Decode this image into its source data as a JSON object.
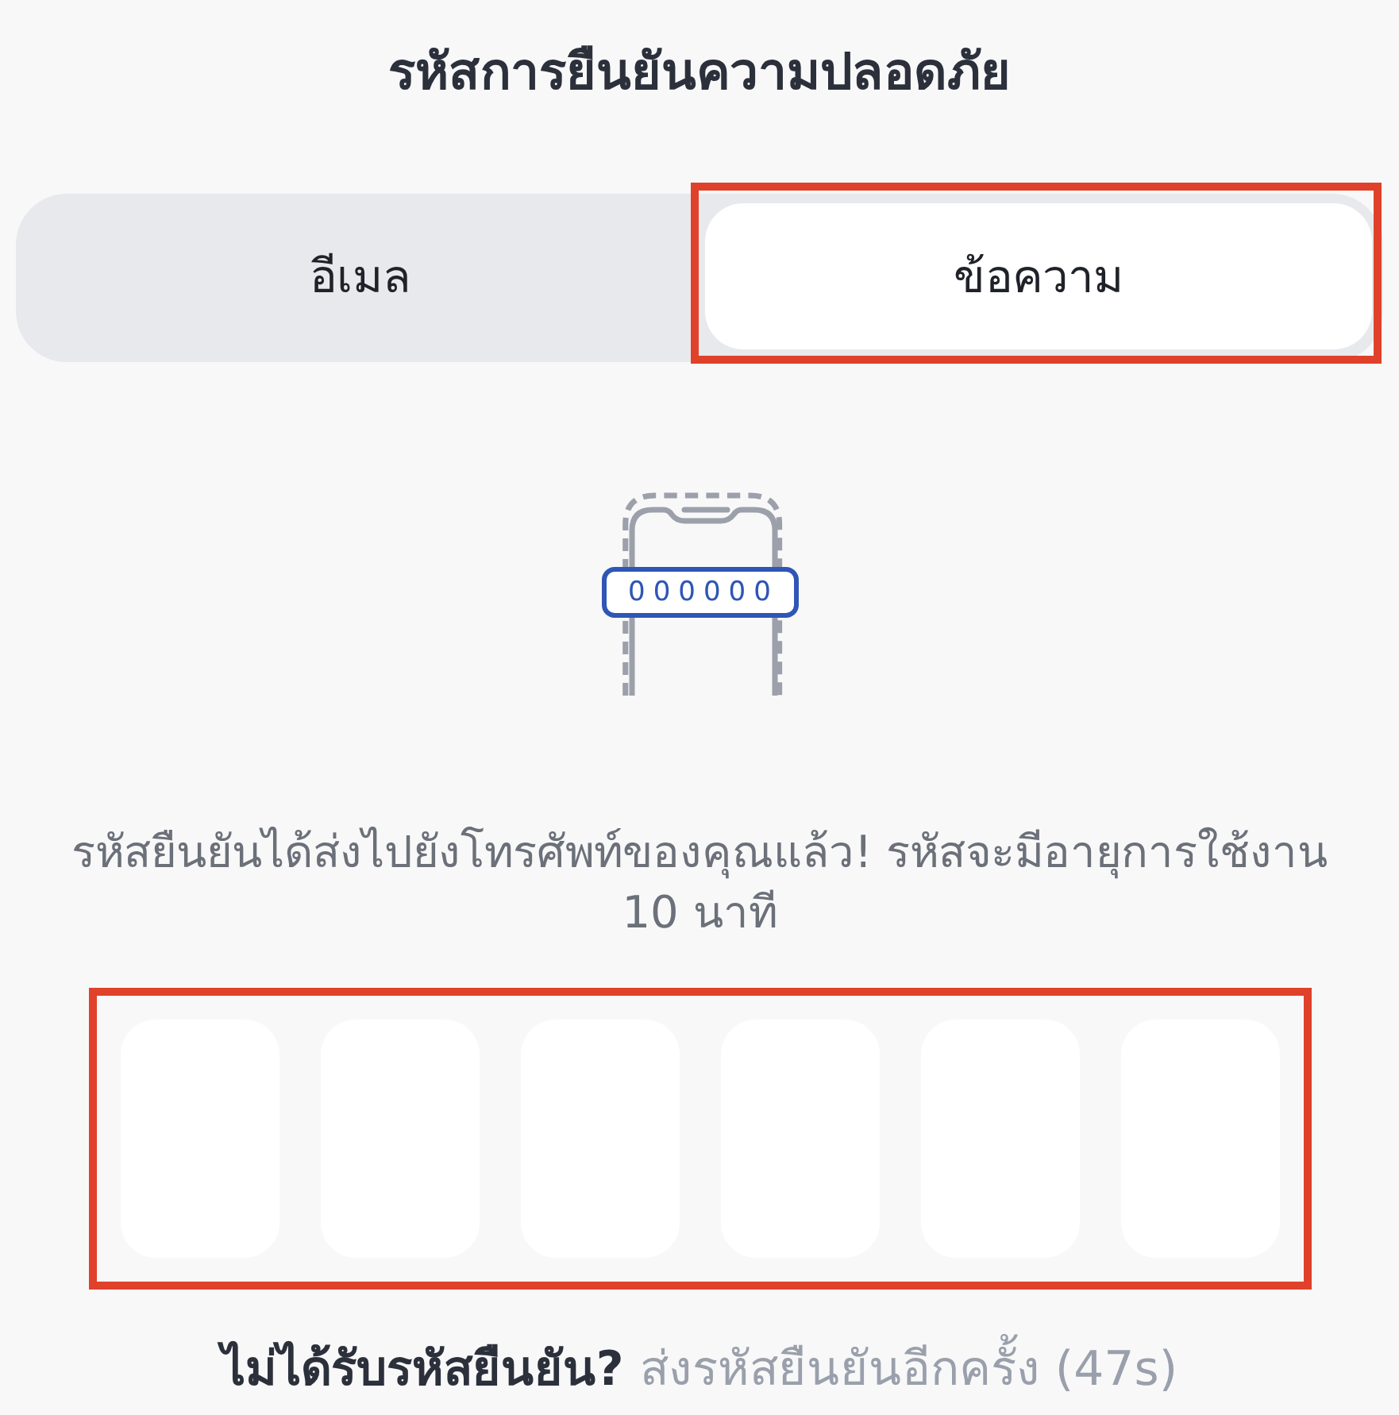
{
  "title": "รหัสการยืนยันความปลอดภัย",
  "tabs": [
    {
      "label": "อีเมล",
      "selected": false,
      "highlighted": false
    },
    {
      "label": "ข้อความ",
      "selected": true,
      "highlighted": true
    }
  ],
  "illustration": {
    "code_sample": "000000"
  },
  "message": "รหัสยืนยันได้ส่งไปยังโทรศัพท์ของคุณแล้ว! รหัสจะมีอายุการใช้งาน 10 นาที",
  "code_input": {
    "highlighted": true,
    "cells": [
      {
        "filled": false
      },
      {
        "filled": false
      },
      {
        "filled": false
      },
      {
        "filled": false
      },
      {
        "filled": false
      },
      {
        "filled": false
      }
    ]
  },
  "resend": {
    "prompt": "ไม่ได้รับรหัสยืนยัน?",
    "link": "ส่งรหัสยืนยันอีกครั้ง (47s)",
    "disabled": true
  }
}
